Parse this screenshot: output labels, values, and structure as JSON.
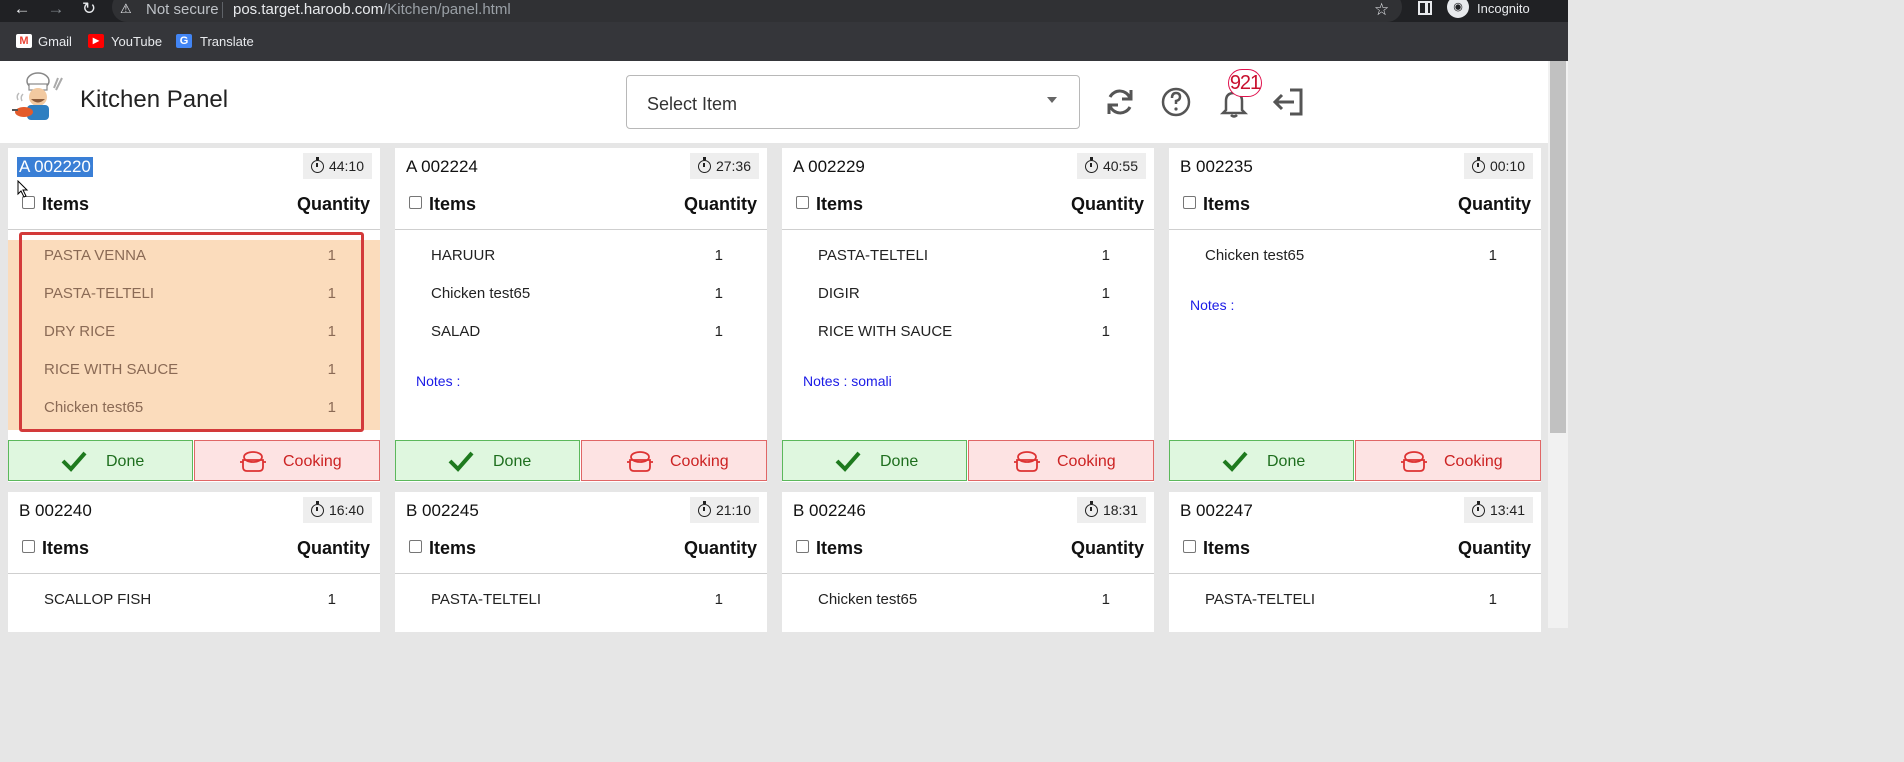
{
  "browser": {
    "not_secure": "Not secure",
    "url_host": "pos.target.haroob.com",
    "url_path": "/Kitchen/panel.html",
    "profile": "Incognito",
    "bookmarks": [
      "Gmail",
      "YouTube",
      "Translate"
    ]
  },
  "header": {
    "title": "Kitchen Panel",
    "select_placeholder": "Select Item",
    "notification_count": "921"
  },
  "columns": {
    "items": "Items",
    "quantity": "Quantity"
  },
  "buttons": {
    "done": "Done",
    "cooking": "Cooking"
  },
  "orders": [
    {
      "ticket": "A 002220",
      "timer": "44:10",
      "notes": "",
      "items": [
        {
          "name": "PASTA VENNA",
          "qty": "1"
        },
        {
          "name": "PASTA-TELTELI",
          "qty": "1"
        },
        {
          "name": "DRY RICE",
          "qty": "1"
        },
        {
          "name": "RICE WITH SAUCE",
          "qty": "1"
        },
        {
          "name": "Chicken test65",
          "qty": "1"
        }
      ]
    },
    {
      "ticket": "A 002224",
      "timer": "27:36",
      "notes": "Notes :",
      "items": [
        {
          "name": "HARUUR",
          "qty": "1"
        },
        {
          "name": "Chicken test65",
          "qty": "1"
        },
        {
          "name": "SALAD",
          "qty": "1"
        }
      ]
    },
    {
      "ticket": "A 002229",
      "timer": "40:55",
      "notes": "Notes : somali",
      "items": [
        {
          "name": "PASTA-TELTELI",
          "qty": "1"
        },
        {
          "name": "DIGIR",
          "qty": "1"
        },
        {
          "name": "RICE WITH SAUCE",
          "qty": "1"
        }
      ]
    },
    {
      "ticket": "B 002235",
      "timer": "00:10",
      "notes": "Notes :",
      "items": [
        {
          "name": "Chicken test65",
          "qty": "1"
        }
      ]
    },
    {
      "ticket": "B 002240",
      "timer": "16:40",
      "items": [
        {
          "name": "SCALLOP FISH",
          "qty": "1"
        }
      ]
    },
    {
      "ticket": "B 002245",
      "timer": "21:10",
      "items": [
        {
          "name": "PASTA-TELTELI",
          "qty": "1"
        }
      ]
    },
    {
      "ticket": "B 002246",
      "timer": "18:31",
      "items": [
        {
          "name": "Chicken test65",
          "qty": "1"
        }
      ]
    },
    {
      "ticket": "B 002247",
      "timer": "13:41",
      "items": [
        {
          "name": "PASTA-TELTELI",
          "qty": "1"
        }
      ]
    }
  ]
}
